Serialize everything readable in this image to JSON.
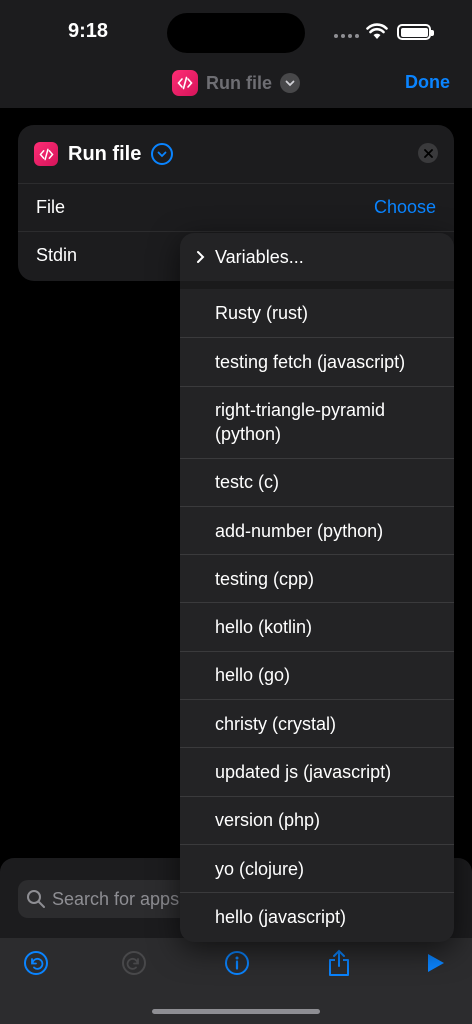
{
  "status": {
    "time": "9:18"
  },
  "nav": {
    "title": "Run file",
    "done": "Done"
  },
  "action": {
    "title": "Run file",
    "rows": [
      {
        "label": "File",
        "value": "Choose"
      },
      {
        "label": "Stdin"
      }
    ]
  },
  "menu": {
    "variables": "Variables...",
    "items": [
      "Rusty (rust)",
      "testing fetch (javascript)",
      "right-triangle-pyramid (python)",
      "testc (c)",
      "add-number (python)",
      "testing (cpp)",
      "hello (kotlin)",
      "hello (go)",
      "christy (crystal)",
      "updated js (javascript)",
      "version (php)",
      "yo (clojure)",
      "hello (javascript)"
    ]
  },
  "search": {
    "placeholder": "Search for apps and actions"
  },
  "colors": {
    "accent": "#0a84ff",
    "app_icon": "#ff2d75"
  },
  "icons": [
    "code-app-icon",
    "chevron-down-icon",
    "close-icon",
    "chevron-right-icon",
    "search-icon",
    "undo-icon",
    "redo-icon",
    "info-icon",
    "share-icon",
    "play-icon"
  ]
}
